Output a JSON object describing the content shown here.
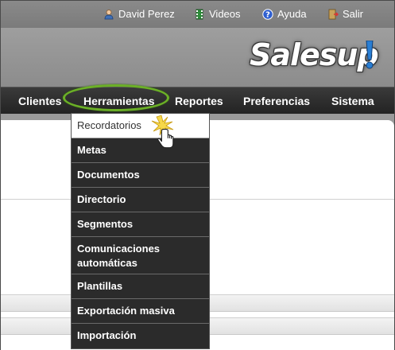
{
  "topbar": {
    "user_name": "David Perez",
    "videos_label": "Videos",
    "help_label": "Ayuda",
    "exit_label": "Salir"
  },
  "logo": {
    "text": "Salesup"
  },
  "nav": {
    "items": [
      "Clientes",
      "Herramientas",
      "Reportes",
      "Preferencias",
      "Sistema"
    ]
  },
  "dropdown": {
    "items": [
      "Recordatorios",
      "Metas",
      "Documentos",
      "Directorio",
      "Segmentos",
      "Comunicaciones automáticas",
      "Plantillas",
      "Exportación masiva",
      "Importación"
    ],
    "active_index": 0
  },
  "colors": {
    "nav_bg": "#2b2b2b",
    "highlight_ring": "#6bb026",
    "logo_accent": "#2a7fd4"
  }
}
